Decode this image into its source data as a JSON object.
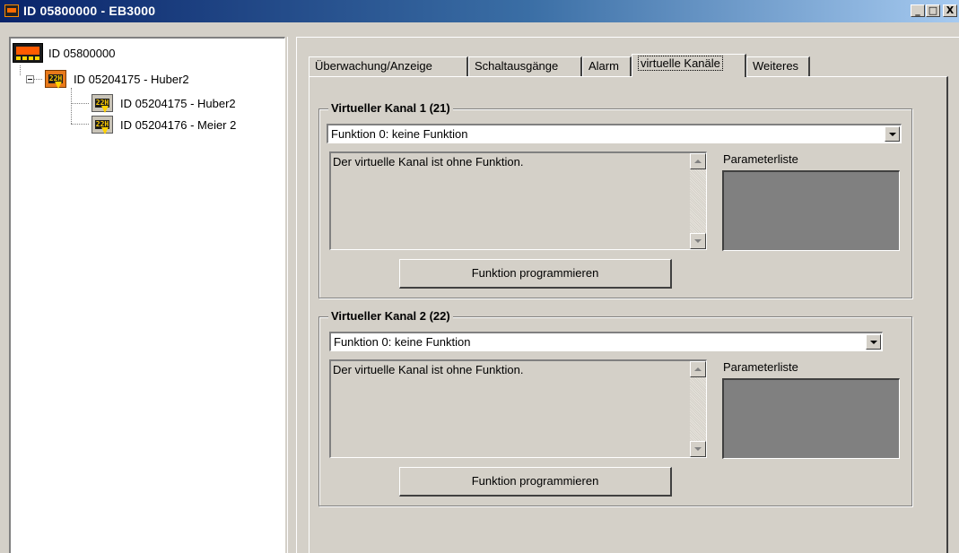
{
  "window": {
    "title": "ID 05800000 - EB3000",
    "min": "_",
    "max": "□",
    "close": "X"
  },
  "tree": {
    "root": "ID 05800000",
    "parent": "ID 05204175 - Huber2",
    "children": [
      "ID 05204175 - Huber2",
      "ID 05204176 - Meier 2"
    ],
    "icon_screen": "22H"
  },
  "tabs": [
    {
      "label": "Überwachung/Anzeige",
      "active": false
    },
    {
      "label": "Schaltausgänge",
      "active": false
    },
    {
      "label": "Alarm",
      "active": false
    },
    {
      "label": "virtuelle Kanäle",
      "active": true
    },
    {
      "label": "Weiteres",
      "active": false
    }
  ],
  "channels": [
    {
      "title": "Virtueller Kanal 1 (21)",
      "function": "Funktion 0:  keine Funktion",
      "description": "Der virtuelle Kanal ist ohne Funktion.",
      "param_label": "Parameterliste",
      "button": "Funktion programmieren"
    },
    {
      "title": "Virtueller Kanal 2 (22)",
      "function": "Funktion 0:  keine Funktion",
      "description": "Der virtuelle Kanal ist ohne Funktion.",
      "param_label": "Parameterliste",
      "button": "Funktion programmieren"
    }
  ]
}
